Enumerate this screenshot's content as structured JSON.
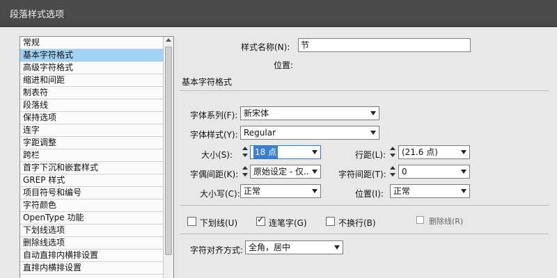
{
  "window": {
    "title": "段落样式选项"
  },
  "categories": [
    "常规",
    "基本字符格式",
    "高级字符格式",
    "缩进和间距",
    "制表符",
    "段落线",
    "保持选项",
    "连字",
    "字距调整",
    "跨栏",
    "首字下沉和嵌套样式",
    "GREP 样式",
    "项目符号和编号",
    "字符颜色",
    "OpenType 功能",
    "下划线选项",
    "删除线选项",
    "自动直排内横排设置",
    "直排内横排设置"
  ],
  "selected_category": "基本字符格式",
  "style_name": {
    "label": "样式名称(N):",
    "value": "节"
  },
  "position_label": "位置:",
  "section_title": "基本字符格式",
  "font_family": {
    "label": "字体系列(F):",
    "value": "新宋体"
  },
  "font_style": {
    "label": "字体样式(Y):",
    "value": "Regular"
  },
  "size": {
    "label": "大小(S):",
    "value": "18 点"
  },
  "leading": {
    "label": "行距(L):",
    "value": "(21.6 点)"
  },
  "kerning": {
    "label": "字偶间距(K):",
    "value": "原始设定 - 仅..."
  },
  "tracking": {
    "label": "字符间距(T):",
    "value": "0"
  },
  "case": {
    "label": "大小写(C):",
    "value": "正常"
  },
  "position": {
    "label": "位置(I):",
    "value": "正常"
  },
  "checkboxes": {
    "underline": {
      "label": "下划线(U)",
      "checked": false
    },
    "ligatures": {
      "label": "连笔字(G)",
      "checked": true
    },
    "no_break": {
      "label": "不换行(B)",
      "checked": false
    },
    "strikethrough": {
      "label": "删除线(R)",
      "checked": false
    }
  },
  "char_alignment": {
    "label": "字符对齐方式:",
    "value": "全角，居中"
  }
}
